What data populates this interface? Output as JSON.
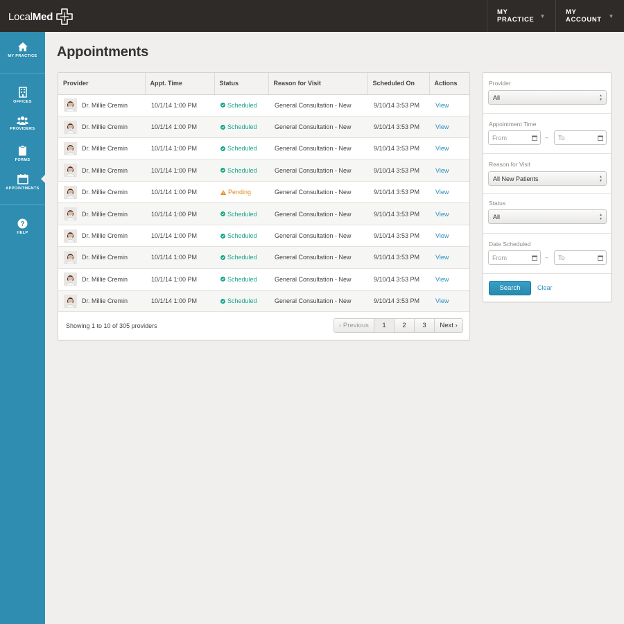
{
  "app": {
    "logo_light": "Local",
    "logo_bold": "Med"
  },
  "topnav": {
    "practice": "MY PRACTICE",
    "account": "MY ACCOUNT"
  },
  "sidebar": {
    "items": [
      {
        "label": "MY PRACTICE",
        "icon": "home-icon"
      },
      {
        "label": "OFFICES",
        "icon": "building-icon"
      },
      {
        "label": "PROVIDERS",
        "icon": "people-icon"
      },
      {
        "label": "FORMS",
        "icon": "clipboard-icon"
      },
      {
        "label": "APPOINTMENTS",
        "icon": "calendar-icon",
        "active": true
      },
      {
        "label": "HELP",
        "icon": "help-icon"
      }
    ]
  },
  "page": {
    "title": "Appointments"
  },
  "table": {
    "columns": [
      "Provider",
      "Appt. Time",
      "Status",
      "Reason for Visit",
      "Scheduled On",
      "Actions"
    ],
    "rows": [
      {
        "provider": "Dr. Millie Cremin",
        "time": "10/1/14 1:00 PM",
        "status": "Scheduled",
        "reason": "General Consultation - New",
        "scheduled": "9/10/14 3:53 PM",
        "action": "View"
      },
      {
        "provider": "Dr. Millie Cremin",
        "time": "10/1/14 1:00 PM",
        "status": "Scheduled",
        "reason": "General Consultation - New",
        "scheduled": "9/10/14 3:53 PM",
        "action": "View"
      },
      {
        "provider": "Dr. Millie Cremin",
        "time": "10/1/14 1:00 PM",
        "status": "Scheduled",
        "reason": "General Consultation - New",
        "scheduled": "9/10/14 3:53 PM",
        "action": "View"
      },
      {
        "provider": "Dr. Millie Cremin",
        "time": "10/1/14 1:00 PM",
        "status": "Scheduled",
        "reason": "General Consultation - New",
        "scheduled": "9/10/14 3:53 PM",
        "action": "View"
      },
      {
        "provider": "Dr. Millie Cremin",
        "time": "10/1/14 1:00 PM",
        "status": "Pending",
        "reason": "General Consultation - New",
        "scheduled": "9/10/14 3:53 PM",
        "action": "View"
      },
      {
        "provider": "Dr. Millie Cremin",
        "time": "10/1/14 1:00 PM",
        "status": "Scheduled",
        "reason": "General Consultation - New",
        "scheduled": "9/10/14 3:53 PM",
        "action": "View"
      },
      {
        "provider": "Dr. Millie Cremin",
        "time": "10/1/14 1:00 PM",
        "status": "Scheduled",
        "reason": "General Consultation - New",
        "scheduled": "9/10/14 3:53 PM",
        "action": "View"
      },
      {
        "provider": "Dr. Millie Cremin",
        "time": "10/1/14 1:00 PM",
        "status": "Scheduled",
        "reason": "General Consultation - New",
        "scheduled": "9/10/14 3:53 PM",
        "action": "View"
      },
      {
        "provider": "Dr. Millie Cremin",
        "time": "10/1/14 1:00 PM",
        "status": "Scheduled",
        "reason": "General Consultation - New",
        "scheduled": "9/10/14 3:53 PM",
        "action": "View"
      },
      {
        "provider": "Dr. Millie Cremin",
        "time": "10/1/14 1:00 PM",
        "status": "Scheduled",
        "reason": "General Consultation - New",
        "scheduled": "9/10/14 3:53 PM",
        "action": "View"
      }
    ],
    "showing": "Showing 1 to 10 of 305 providers",
    "pager": {
      "prev": "‹ Previous",
      "pages": [
        "1",
        "2",
        "3"
      ],
      "next": "Next ›"
    }
  },
  "filters": {
    "provider": {
      "label": "Provider",
      "value": "All"
    },
    "appt_time": {
      "label": "Appointment Time",
      "from": "From",
      "to": "To",
      "dash": "–"
    },
    "reason": {
      "label": "Reason for Visit",
      "value": "All New Patients"
    },
    "status": {
      "label": "Status",
      "value": "All"
    },
    "date_scheduled": {
      "label": "Date Scheduled",
      "from": "From",
      "to": "To",
      "dash": "–"
    },
    "search_label": "Search",
    "clear_label": "Clear"
  },
  "colors": {
    "topbar": "#2e2b28",
    "sidebar": "#2e8db0",
    "scheduled": "#1aa58a",
    "pending": "#e38b1e",
    "link": "#2b8fc1"
  }
}
